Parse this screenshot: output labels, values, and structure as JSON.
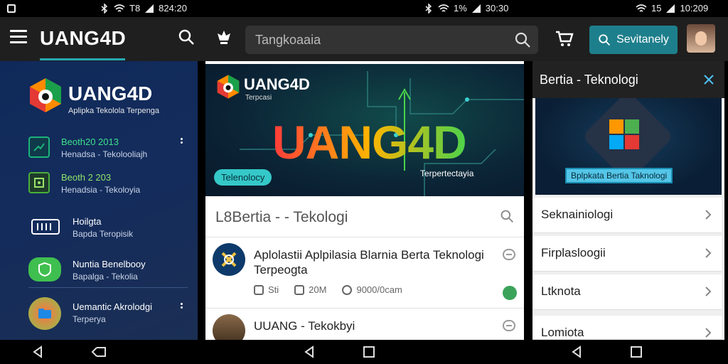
{
  "status_bar": {
    "left_time": "824:20",
    "center_battery": "1%",
    "center_time": "30:30",
    "right_battery": "15",
    "right_time": "10:209"
  },
  "app_bar": {
    "logo": "UANG4D",
    "search_placeholder": "Tangkoaaia",
    "search_button_label": "Sevitanely"
  },
  "sidebar": {
    "brand": "UANG4D",
    "tagline": "Aplipka Tekolola Terpenga",
    "items": [
      {
        "title": "Beoth20 2013",
        "subtitle": "Henadsa - Tekolooliajh",
        "icon": "chart-icon",
        "color": "#1db37a"
      },
      {
        "title": "Beoth 2 203",
        "subtitle": "Henadsia - Tekoloyia",
        "icon": "image-icon",
        "color": "#4caf3a"
      },
      {
        "title": "Hoilgta",
        "subtitle": "Bapda Teropisik",
        "icon": "scan-icon",
        "color": "#ffffff"
      },
      {
        "title": "Nuntia Benelbooy",
        "subtitle": "Bapalga - Tekolia",
        "icon": "shield-icon",
        "color": "#3fbf4f"
      },
      {
        "title": "Uemantic Akrolodgi",
        "subtitle": "Terperya",
        "icon": "folder-icon",
        "color": "#1e88e5"
      }
    ]
  },
  "banner": {
    "brand": "UANG4D",
    "tag": "Terpcasi",
    "big_text": "UANG4D",
    "pill": "Telenolocy",
    "note": "Terpertectayia"
  },
  "feed": {
    "section_title": "L8Bertia - - Tekologi",
    "articles": [
      {
        "title": "Aplolastii Aplpilasia Blarnia Berta Teknologi Terpeogta",
        "meta": [
          "Sti",
          "20M",
          "9000/0cam"
        ]
      },
      {
        "title": "UUANG - Tekokbyi",
        "meta": []
      }
    ]
  },
  "right_panel": {
    "title": "Bertia - Teknologi",
    "image_caption": "Bplpkata Bertia Taknologi",
    "items": [
      "Seknainiologi",
      "Firplasloogii",
      "Ltknota",
      "Lomiota"
    ]
  },
  "colors": {
    "accent": "#26a9b3",
    "search_button": "#1e7f8c",
    "sidebar_bg": "#142c5c",
    "badge_green": "#3aa35a"
  }
}
